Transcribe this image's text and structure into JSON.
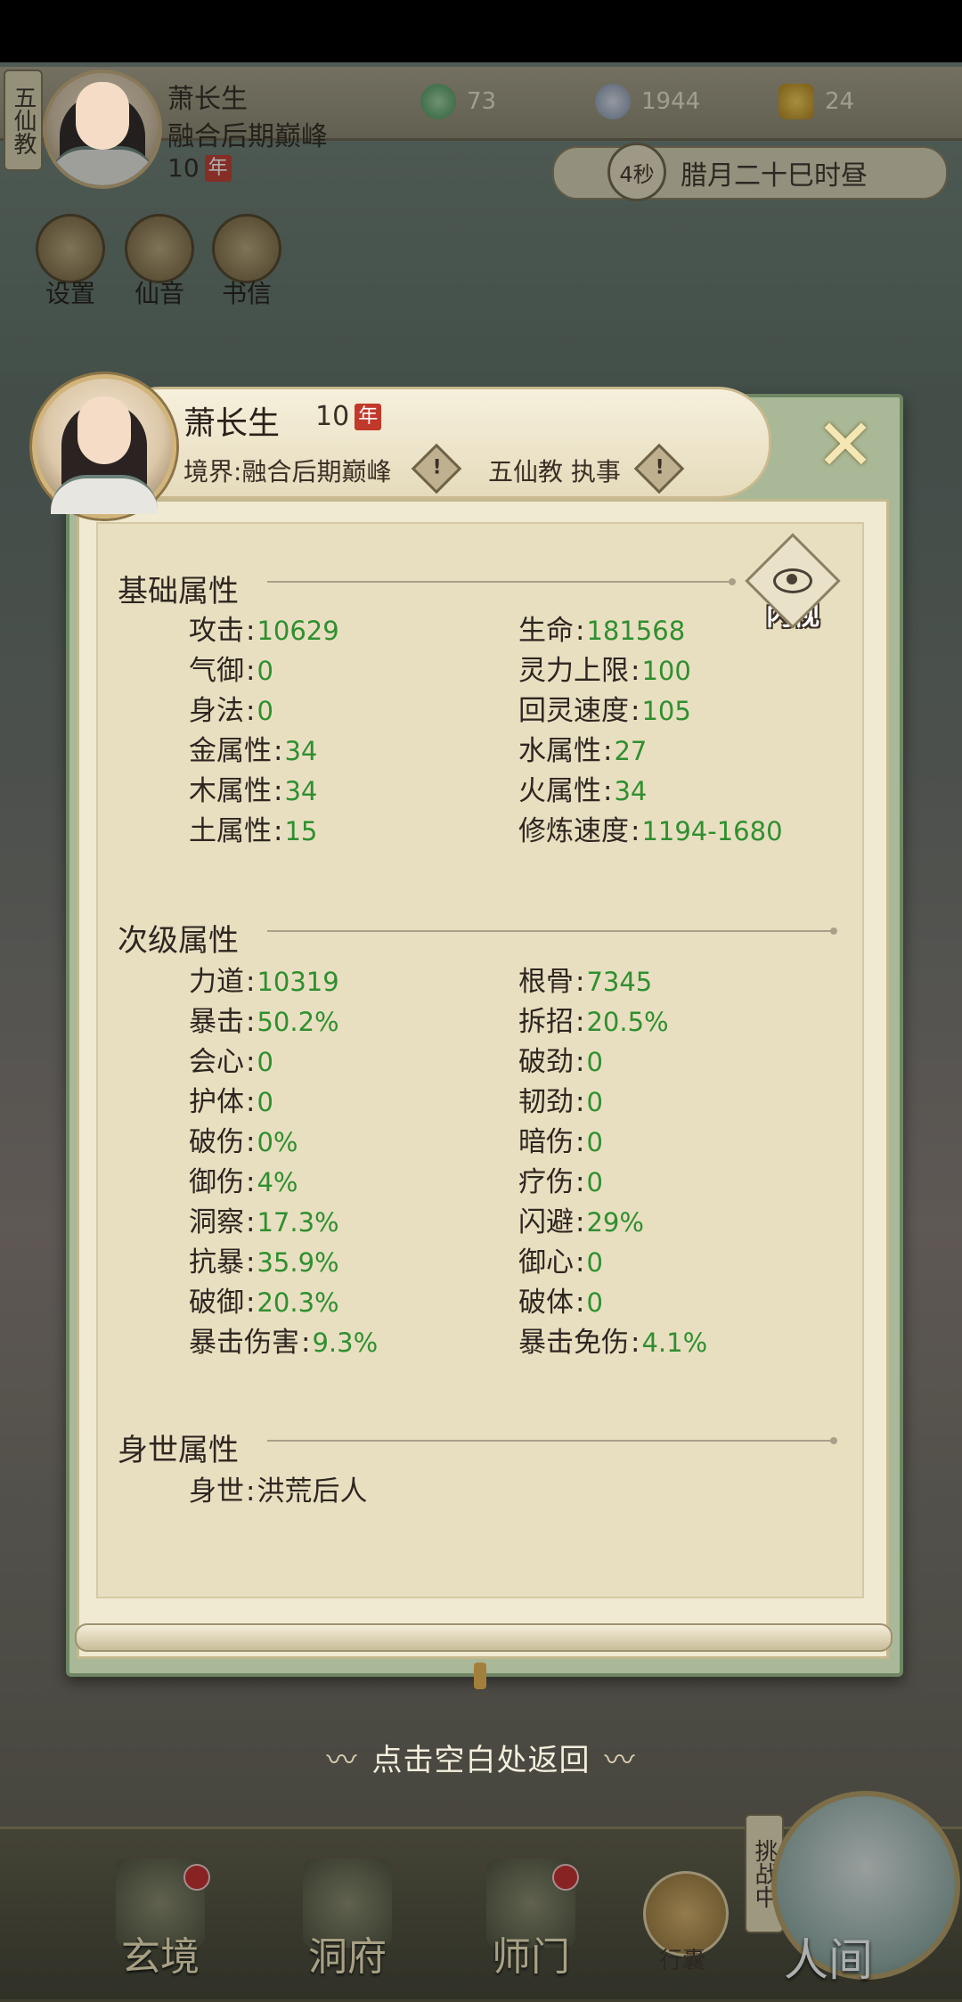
{
  "top": {
    "sect_tag": "五仙教",
    "name": "萧长生",
    "realm": "融合后期巅峰",
    "age": "10",
    "age_unit": "年",
    "resources": [
      {
        "icon": "jade-icon",
        "value": "73"
      },
      {
        "icon": "coin-icon",
        "value": "1944"
      },
      {
        "icon": "strength-icon",
        "value": "24"
      }
    ],
    "timer": "4秒",
    "calendar": "腊月二十巳时昼",
    "quick_buttons": [
      {
        "icon": "settings-icon",
        "label": "设置"
      },
      {
        "icon": "immortal-sound-icon",
        "label": "仙音"
      },
      {
        "icon": "letter-icon",
        "label": "书信"
      }
    ]
  },
  "dialog": {
    "name": "萧长生",
    "age": "10",
    "age_unit": "年",
    "realm_label": "境界",
    "realm": "融合后期巅峰",
    "sect": "五仙教 执事",
    "info_mark": "!",
    "close": "✕",
    "innerview": "内视",
    "basic_title": "基础属性",
    "basic_stats": [
      {
        "label": "攻击",
        "value": "10629"
      },
      {
        "label": "生命",
        "value": "181568"
      },
      {
        "label": "气御",
        "value": "0"
      },
      {
        "label": "灵力上限",
        "value": "100"
      },
      {
        "label": "身法",
        "value": "0"
      },
      {
        "label": "回灵速度",
        "value": "105"
      },
      {
        "label": "金属性",
        "value": "34"
      },
      {
        "label": "水属性",
        "value": "27"
      },
      {
        "label": "木属性",
        "value": "34"
      },
      {
        "label": "火属性",
        "value": "34"
      },
      {
        "label": "土属性",
        "value": "15"
      },
      {
        "label": "修炼速度",
        "value": "1194-1680"
      }
    ],
    "secondary_title": "次级属性",
    "secondary_stats": [
      {
        "label": "力道",
        "value": "10319"
      },
      {
        "label": "根骨",
        "value": "7345"
      },
      {
        "label": "暴击",
        "value": "50.2%"
      },
      {
        "label": "拆招",
        "value": "20.5%"
      },
      {
        "label": "会心",
        "value": "0"
      },
      {
        "label": "破劲",
        "value": "0"
      },
      {
        "label": "护体",
        "value": "0"
      },
      {
        "label": "韧劲",
        "value": "0"
      },
      {
        "label": "破伤",
        "value": "0%"
      },
      {
        "label": "暗伤",
        "value": "0"
      },
      {
        "label": "御伤",
        "value": "4%"
      },
      {
        "label": "疗伤",
        "value": "0"
      },
      {
        "label": "洞察",
        "value": "17.3%"
      },
      {
        "label": "闪避",
        "value": "29%"
      },
      {
        "label": "抗暴",
        "value": "35.9%"
      },
      {
        "label": "御心",
        "value": "0"
      },
      {
        "label": "破御",
        "value": "20.3%"
      },
      {
        "label": "破体",
        "value": "0"
      },
      {
        "label": "暴击伤害",
        "value": "9.3%"
      },
      {
        "label": "暴击免伤",
        "value": "4.1%"
      }
    ],
    "origin_title": "身世属性",
    "origin_stats": [
      {
        "label": "身世",
        "value": "洪荒后人"
      }
    ]
  },
  "hint": "点击空白处返回",
  "nav": {
    "items": [
      {
        "icon": "mystic-realm-icon",
        "label": "玄境",
        "badge": true
      },
      {
        "icon": "cave-icon",
        "label": "洞府",
        "badge": false
      },
      {
        "icon": "sect-gate-icon",
        "label": "师门",
        "badge": true
      }
    ],
    "bag_label": "行囊",
    "challenge": "挑战中",
    "world_label": "人间"
  },
  "colors": {
    "value_green": "#2f8f2f",
    "frame_green": "#6f8563",
    "parchment": "#e8dfc1"
  }
}
